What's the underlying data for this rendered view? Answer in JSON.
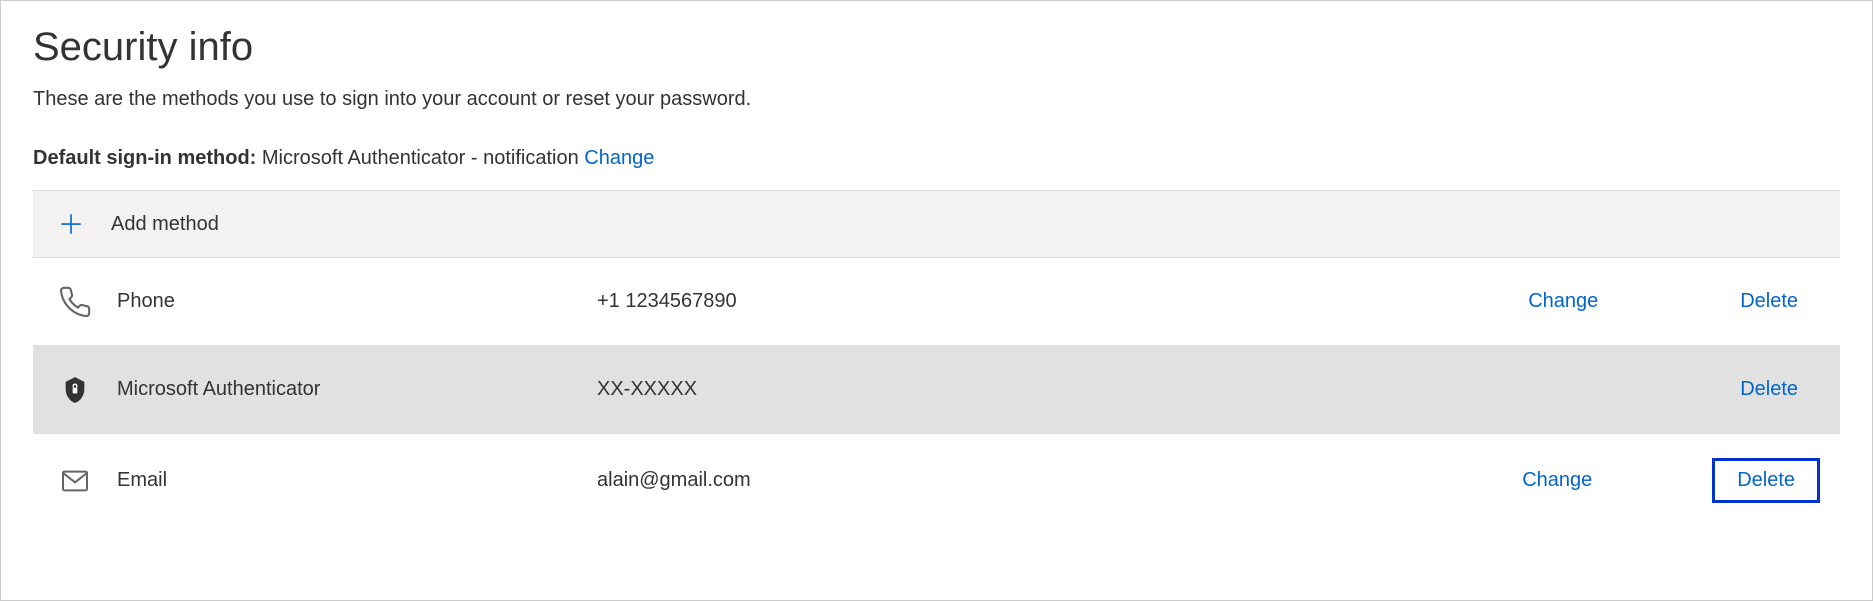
{
  "header": {
    "title": "Security info",
    "subtitle": "These are the methods you use to sign into your account or reset your password."
  },
  "default_method": {
    "label": "Default sign-in method:",
    "value": "Microsoft Authenticator - notification",
    "change_label": "Change"
  },
  "add_method": {
    "label": "Add method"
  },
  "methods": [
    {
      "name": "Phone",
      "value": "+1 1234567890",
      "change_label": "Change",
      "delete_label": "Delete"
    },
    {
      "name": "Microsoft Authenticator",
      "value": "XX-XXXXX",
      "change_label": "",
      "delete_label": "Delete"
    },
    {
      "name": "Email",
      "value": "alain@gmail.com",
      "change_label": "Change",
      "delete_label": "Delete"
    }
  ]
}
